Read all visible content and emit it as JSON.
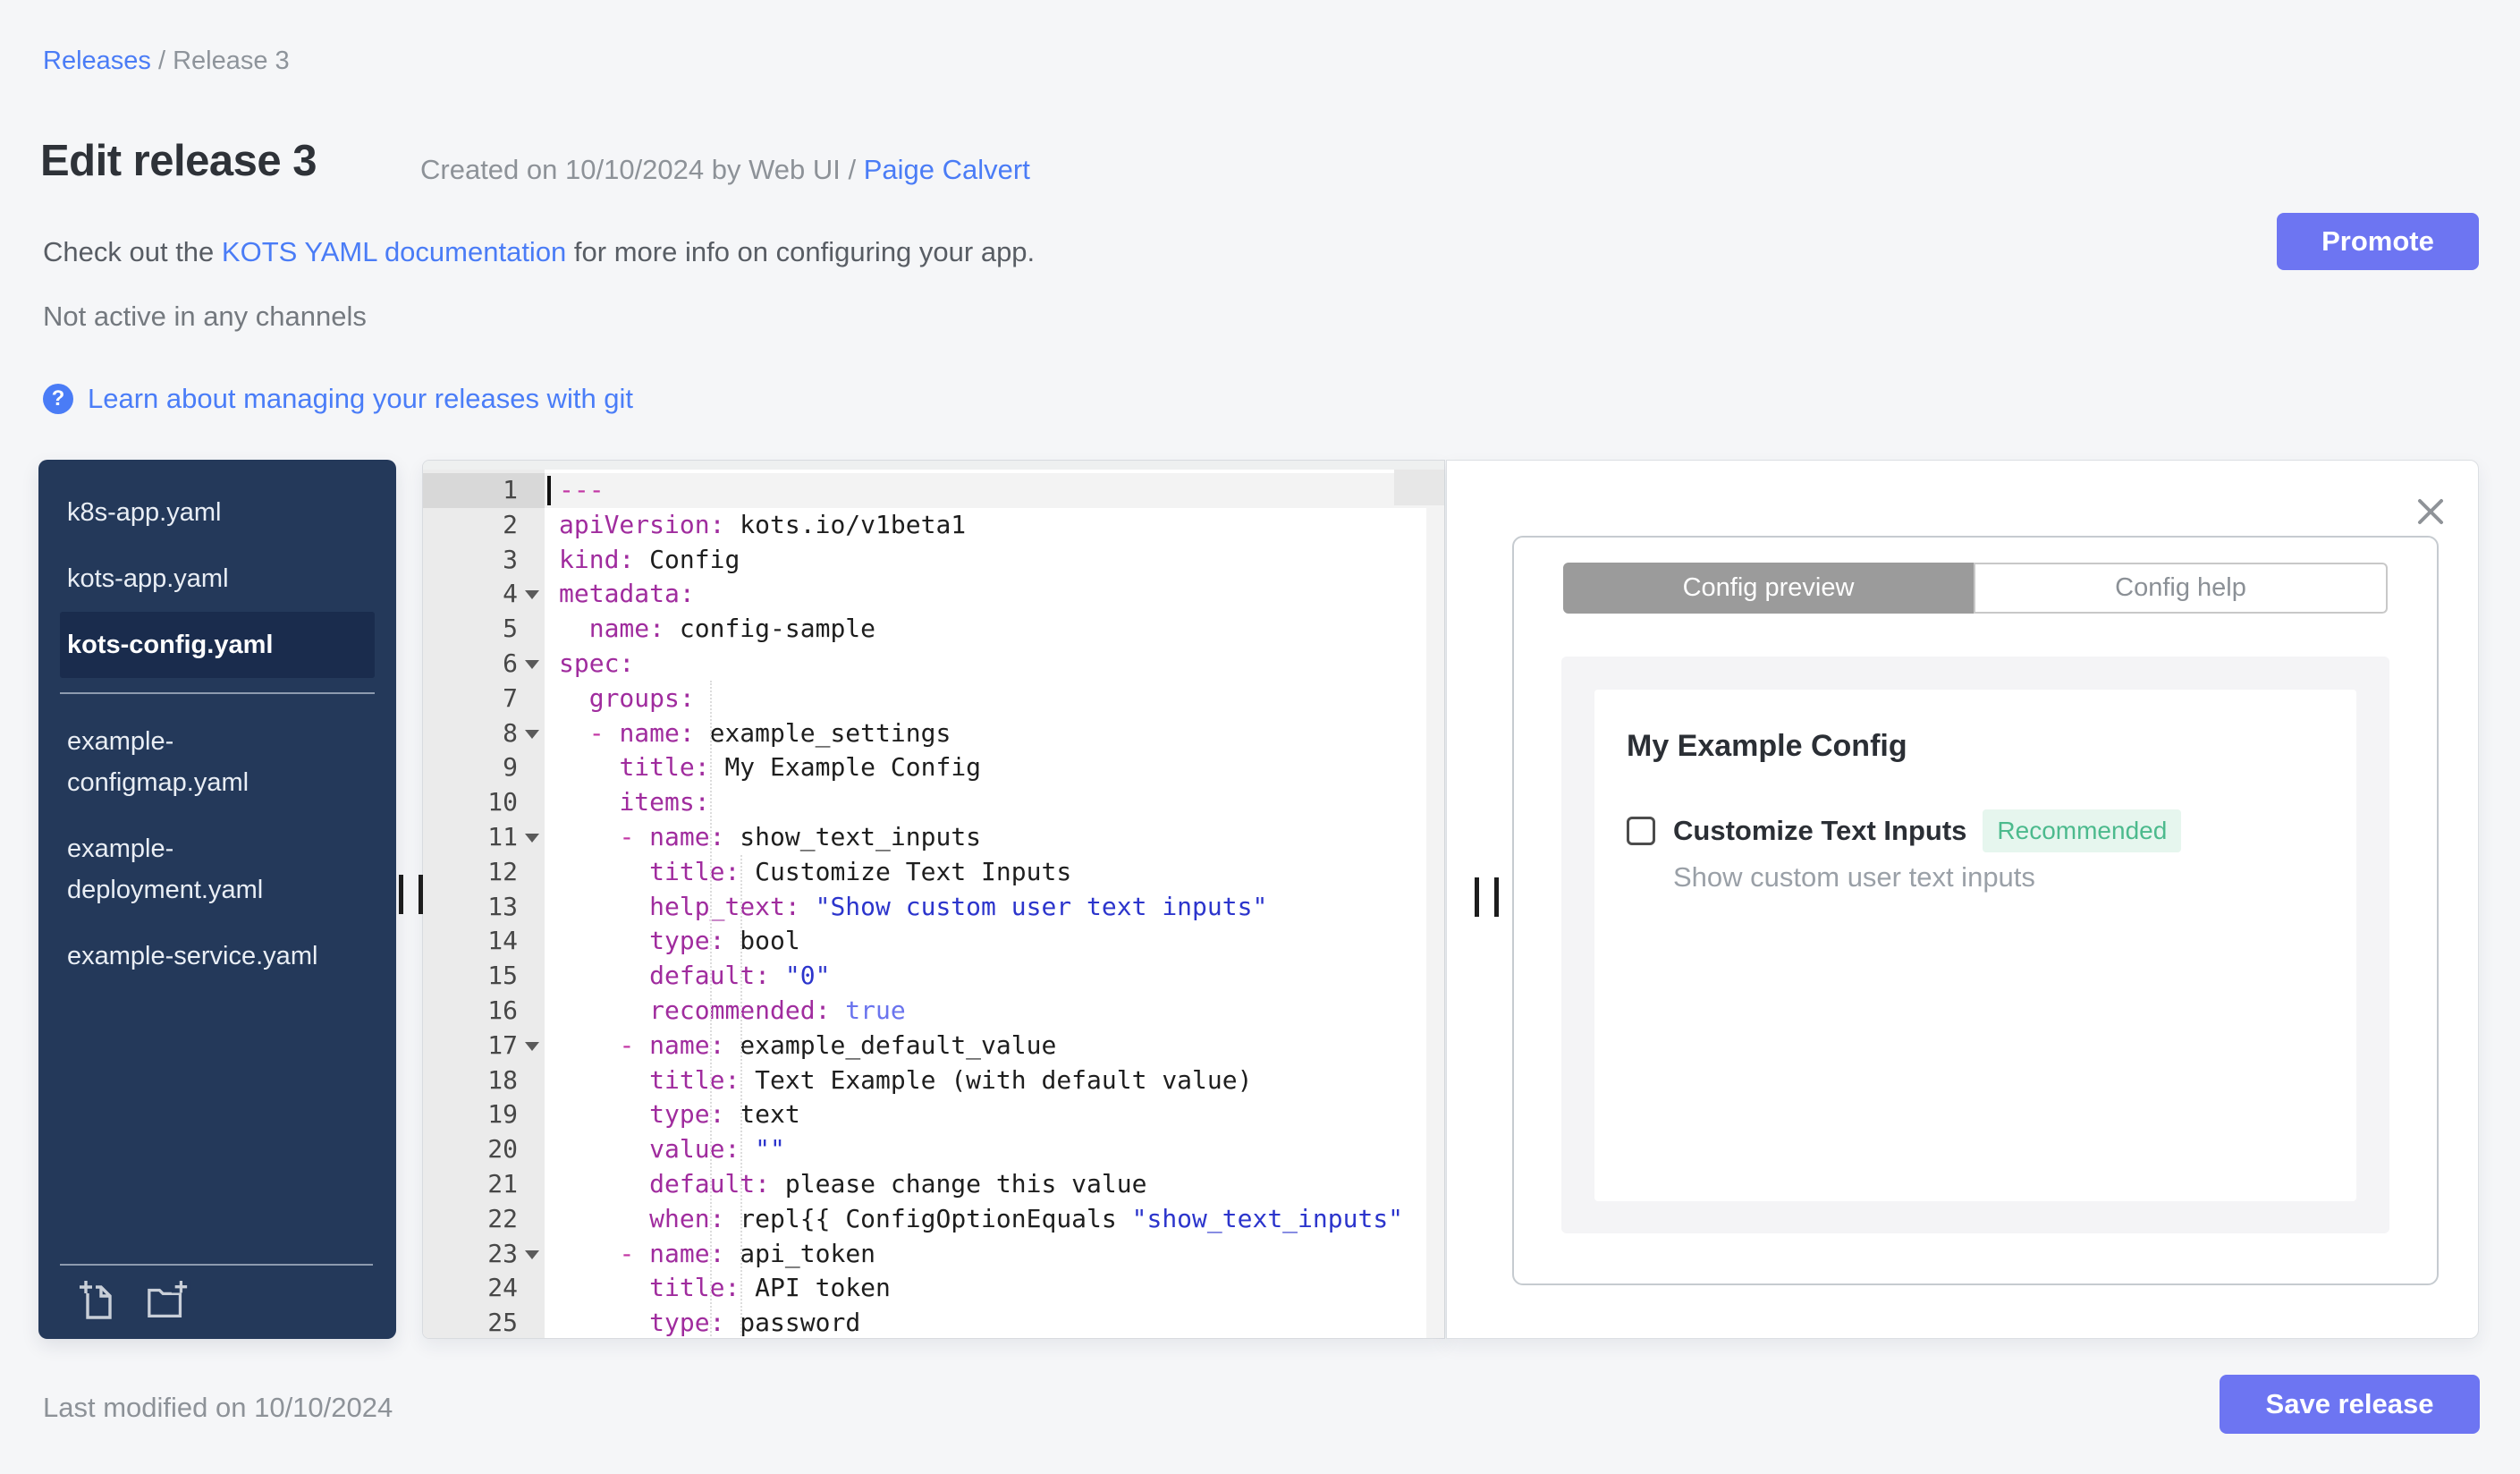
{
  "page": {
    "bg": "#f5f6f8",
    "accent": "#6d75f2",
    "link_color": "#4a7cf6"
  },
  "breadcrumb": {
    "link": "Releases",
    "separator": " / ",
    "current": "Release 3"
  },
  "header": {
    "title": "Edit release 3",
    "created_prefix": "Created on 10/10/2024 by Web UI / ",
    "created_author": "Paige Calvert",
    "docs_prefix": "Check out the ",
    "docs_link": "KOTS YAML documentation",
    "docs_suffix": " for more info on configuring your app.",
    "channel_status": "Not active in any channels",
    "help_icon_glyph": "?",
    "git_link": "Learn about managing your releases with git",
    "promote_label": "Promote"
  },
  "sidebar": {
    "bg": "#24395a",
    "icons": [
      "new-file-icon",
      "new-folder-icon"
    ],
    "files": [
      {
        "name": "k8s-app.yaml",
        "selected": false,
        "section": 1
      },
      {
        "name": "kots-app.yaml",
        "selected": false,
        "section": 1
      },
      {
        "name": "kots-config.yaml",
        "selected": true,
        "section": 1
      },
      {
        "name": "example-configmap.yaml",
        "selected": false,
        "section": 2
      },
      {
        "name": "example-deployment.yaml",
        "selected": false,
        "section": 2
      },
      {
        "name": "example-service.yaml",
        "selected": false,
        "section": 2
      }
    ]
  },
  "editor": {
    "active_line": 1,
    "fold_lines": [
      4,
      6,
      8,
      11,
      17,
      23
    ],
    "syntax_colors": {
      "key": "#a02c9e",
      "dash": "#c338a5",
      "string": "#2c35cc",
      "boolean": "#6a74ee",
      "plain": "#1e1e1e"
    },
    "lines": [
      [
        [
          "d",
          "---"
        ]
      ],
      [
        [
          "k",
          "apiVersion:"
        ],
        [
          "v",
          " kots.io/v1beta1"
        ]
      ],
      [
        [
          "k",
          "kind:"
        ],
        [
          "v",
          " Config"
        ]
      ],
      [
        [
          "k",
          "metadata:"
        ]
      ],
      [
        [
          "v",
          "  "
        ],
        [
          "k",
          "name:"
        ],
        [
          "v",
          " config-sample"
        ]
      ],
      [
        [
          "k",
          "spec:"
        ]
      ],
      [
        [
          "v",
          "  "
        ],
        [
          "k",
          "groups:"
        ]
      ],
      [
        [
          "v",
          "  "
        ],
        [
          "d",
          "- "
        ],
        [
          "k",
          "name:"
        ],
        [
          "v",
          " example_settings"
        ]
      ],
      [
        [
          "v",
          "    "
        ],
        [
          "k",
          "title:"
        ],
        [
          "v",
          " My Example Config"
        ]
      ],
      [
        [
          "v",
          "    "
        ],
        [
          "k",
          "items:"
        ]
      ],
      [
        [
          "v",
          "    "
        ],
        [
          "d",
          "- "
        ],
        [
          "k",
          "name:"
        ],
        [
          "v",
          " show_text_inputs"
        ]
      ],
      [
        [
          "v",
          "      "
        ],
        [
          "k",
          "title:"
        ],
        [
          "v",
          " Customize Text Inputs"
        ]
      ],
      [
        [
          "v",
          "      "
        ],
        [
          "k",
          "help_text:"
        ],
        [
          "s",
          " \"Show custom user text inputs\""
        ]
      ],
      [
        [
          "v",
          "      "
        ],
        [
          "k",
          "type:"
        ],
        [
          "v",
          " bool"
        ]
      ],
      [
        [
          "v",
          "      "
        ],
        [
          "k",
          "default:"
        ],
        [
          "s",
          " \"0\""
        ]
      ],
      [
        [
          "v",
          "      "
        ],
        [
          "k",
          "recommended:"
        ],
        [
          "b",
          " true"
        ]
      ],
      [
        [
          "v",
          "    "
        ],
        [
          "d",
          "- "
        ],
        [
          "k",
          "name:"
        ],
        [
          "v",
          " example_default_value"
        ]
      ],
      [
        [
          "v",
          "      "
        ],
        [
          "k",
          "title:"
        ],
        [
          "v",
          " Text Example (with default value)"
        ]
      ],
      [
        [
          "v",
          "      "
        ],
        [
          "k",
          "type:"
        ],
        [
          "v",
          " text"
        ]
      ],
      [
        [
          "v",
          "      "
        ],
        [
          "k",
          "value:"
        ],
        [
          "s",
          " \"\""
        ]
      ],
      [
        [
          "v",
          "      "
        ],
        [
          "k",
          "default:"
        ],
        [
          "v",
          " please change this value"
        ]
      ],
      [
        [
          "v",
          "      "
        ],
        [
          "k",
          "when:"
        ],
        [
          "v",
          " repl{{ ConfigOptionEquals "
        ],
        [
          "s",
          "\"show_text_inputs\""
        ]
      ],
      [
        [
          "v",
          "    "
        ],
        [
          "d",
          "- "
        ],
        [
          "k",
          "name:"
        ],
        [
          "v",
          " api_token"
        ]
      ],
      [
        [
          "v",
          "      "
        ],
        [
          "k",
          "title:"
        ],
        [
          "v",
          " API token"
        ]
      ],
      [
        [
          "v",
          "      "
        ],
        [
          "k",
          "type:"
        ],
        [
          "v",
          " password"
        ]
      ]
    ]
  },
  "preview": {
    "tabs": [
      "Config preview",
      "Config help"
    ],
    "active_tab": "Config preview",
    "group_title": "My Example Config",
    "item_label": "Customize Text Inputs",
    "item_checked": false,
    "badge": "Recommended",
    "badge_color": "#4cba8d",
    "help_text": "Show custom user text inputs"
  },
  "footer": {
    "last_modified": "Last modified on 10/10/2024",
    "save_label": "Save release"
  }
}
